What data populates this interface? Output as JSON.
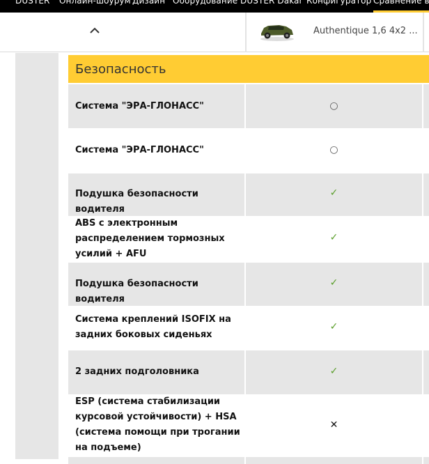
{
  "nav": {
    "items": [
      "DUSTER",
      "Онлайн-шоурум",
      "Дизайн",
      "Оборудование",
      "DUSTER Dakar",
      "Конфигуратор",
      "Сравнение версий"
    ]
  },
  "compare": {
    "car_name": "Authentique 1,6 4x2 ...",
    "collapse_icon": "chevron-up-icon"
  },
  "section": {
    "title": "Безопасность"
  },
  "rows": [
    {
      "label": "Система \"ЭРА-ГЛОНАСС\"",
      "value": "○",
      "kind": "circle"
    },
    {
      "label": "Система \"ЭРА-ГЛОНАСС\"",
      "value": "○",
      "kind": "circle"
    },
    {
      "label": "Подушка безопасности водителя",
      "value": "✓",
      "kind": "check"
    },
    {
      "label": "ABS с электронным распределением тормозных усилий + AFU",
      "value": "✓",
      "kind": "check"
    },
    {
      "label": "Подушка безопасности водителя",
      "value": "✓",
      "kind": "check"
    },
    {
      "label": "Система креплений ISOFIX на задних боковых сиденьях",
      "value": "✓",
      "kind": "check"
    },
    {
      "label": "2 задних подголовника",
      "value": "✓",
      "kind": "check"
    },
    {
      "label": "ESP (система стабилизации курсовой устойчивости) + HSA (система помощи при трогании на подъеме)",
      "value": "✕",
      "kind": "cross"
    }
  ],
  "colors": {
    "accent": "#ffcc33",
    "check": "#5a9e2a",
    "row_shade": "#e6e6e6"
  }
}
